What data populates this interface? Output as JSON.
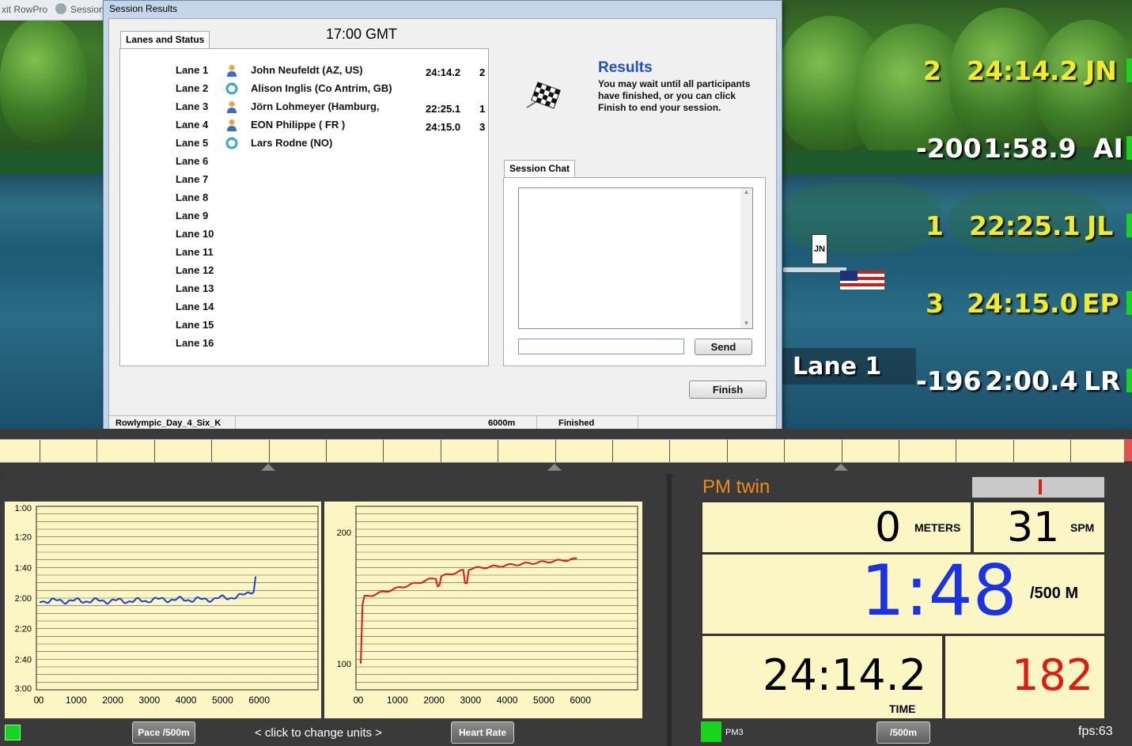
{
  "topbar": {
    "left_text": "xit RowPro",
    "session_text": "Session"
  },
  "dialog": {
    "title": "Session Results",
    "time": "17:00 GMT",
    "lanes_tab": "Lanes and Status",
    "lanes": [
      {
        "lane": "Lane 1",
        "name": "John Neufeldt (AZ, US)",
        "time": "24:14.2",
        "pos": "2",
        "icon": "person-icon"
      },
      {
        "lane": "Lane 2",
        "name": "Alison Inglis (Co Antrim, GB)",
        "time": "",
        "pos": "",
        "icon": "sync-icon"
      },
      {
        "lane": "Lane 3",
        "name": "Jörn Lohmeyer (Hamburg,",
        "time": "22:25.1",
        "pos": "1",
        "icon": "person-icon"
      },
      {
        "lane": "Lane 4",
        "name": "EON Philippe  ( FR )",
        "time": "24:15.0",
        "pos": "3",
        "icon": "person-icon"
      },
      {
        "lane": "Lane 5",
        "name": "Lars Rodne (NO)",
        "time": "",
        "pos": "",
        "icon": "sync-icon"
      },
      {
        "lane": "Lane 6",
        "name": "",
        "time": "",
        "pos": "",
        "icon": ""
      },
      {
        "lane": "Lane 7",
        "name": "",
        "time": "",
        "pos": "",
        "icon": ""
      },
      {
        "lane": "Lane 8",
        "name": "",
        "time": "",
        "pos": "",
        "icon": ""
      },
      {
        "lane": "Lane 9",
        "name": "",
        "time": "",
        "pos": "",
        "icon": ""
      },
      {
        "lane": "Lane 10",
        "name": "",
        "time": "",
        "pos": "",
        "icon": ""
      },
      {
        "lane": "Lane 11",
        "name": "",
        "time": "",
        "pos": "",
        "icon": ""
      },
      {
        "lane": "Lane 12",
        "name": "",
        "time": "",
        "pos": "",
        "icon": ""
      },
      {
        "lane": "Lane 13",
        "name": "",
        "time": "",
        "pos": "",
        "icon": ""
      },
      {
        "lane": "Lane 14",
        "name": "",
        "time": "",
        "pos": "",
        "icon": ""
      },
      {
        "lane": "Lane 15",
        "name": "",
        "time": "",
        "pos": "",
        "icon": ""
      },
      {
        "lane": "Lane 16",
        "name": "",
        "time": "",
        "pos": "",
        "icon": ""
      }
    ],
    "results_heading": "Results",
    "results_text": "You may wait until all participants have finished, or you can click Finish to end your session.",
    "chat_tab": "Session Chat",
    "chat_input_value": "",
    "send_label": "Send",
    "finish_label": "Finish",
    "status": {
      "session": "Rowlympic_Day_4_Six_K",
      "distance": "6000m",
      "state": "Finished"
    }
  },
  "hud": [
    {
      "pos": "2",
      "time": "24:14.2",
      "code": "JN"
    },
    {
      "pos": "-200",
      "time": "1:58.9",
      "code": "AI"
    },
    {
      "pos": "1",
      "time": "22:25.1",
      "code": "JL"
    },
    {
      "pos": "3",
      "time": "24:15.0",
      "code": "EP"
    },
    {
      "pos": "-196",
      "time": "2:00.4",
      "code": "LR"
    }
  ],
  "scene": {
    "lane_label": "Lane  1",
    "boat_tag": "JN"
  },
  "pace_chart": {
    "y_ticks": [
      "1:00",
      "1:20",
      "1:40",
      "2:00",
      "2:20",
      "2:40",
      "3:00"
    ],
    "x_ticks": [
      "1000",
      "2000",
      "3000",
      "4000",
      "5000",
      "6000"
    ],
    "x_origin": "0",
    "x_origin_2": "0",
    "color": "#1a3fd6"
  },
  "hr_chart": {
    "y_ticks": [
      "200",
      "100"
    ],
    "x_ticks": [
      "1000",
      "2000",
      "3000",
      "4000",
      "5000",
      "6000"
    ],
    "x_origin": "0",
    "x_origin_2": "0",
    "color": "#e01a10"
  },
  "controls": {
    "pace_btn": "Pace /500m",
    "change_units": "<  click to change units  >",
    "hr_btn": "Heart Rate"
  },
  "pm": {
    "title": "PM twin",
    "meters": "0",
    "meters_unit": "METERS",
    "spm": "31",
    "spm_unit": "SPM",
    "pace": "1:48",
    "pace_unit": "/500 M",
    "time": "24:14.2",
    "time_unit": "TIME",
    "hr": "182",
    "model": "PM3",
    "unit_btn": "/500m",
    "fps": "fps:63"
  },
  "colors": {
    "hud_yellow": "#f3ea2a",
    "pace_blue": "#1a33e6",
    "hr_red": "#e01a10",
    "panel_bg": "#fbf6c4",
    "accent_orange": "#f08c14"
  }
}
